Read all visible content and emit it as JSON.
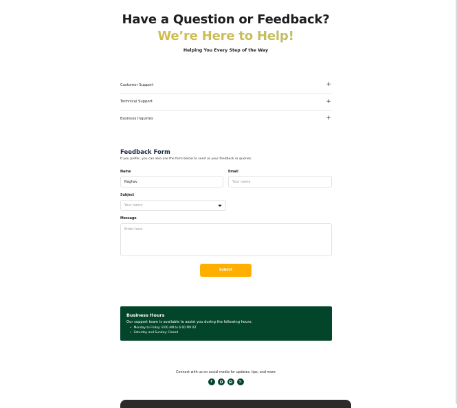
{
  "hero": {
    "title": "Have a Question or Feedback?",
    "subtitle": "We’re Here to Help!",
    "tagline": "Helping You Every Step of the Way"
  },
  "accordion": [
    {
      "label": "Customer Support",
      "icon": "plus-icon"
    },
    {
      "label": "Technical Support",
      "icon": "plus-icon"
    },
    {
      "label": "Business Inquiries",
      "icon": "plus-icon"
    }
  ],
  "form": {
    "title": "Feedback Form",
    "description": "If you prefer, you can also use the form below to send us your feedback or queries.",
    "name_label": "Name",
    "name_value": "Raghav",
    "email_label": "Email",
    "email_placeholder": "Your name",
    "subject_label": "Subject",
    "subject_placeholder": "Your name",
    "message_label": "Message",
    "message_placeholder": "Enter here",
    "submit_label": "Submit"
  },
  "business_hours": {
    "title": "Business Hours",
    "intro": "Our support team is available to assist you during the following hours:",
    "items": [
      "Monday to Friday: 9:00 AM to 6:00 PM IST",
      "Saturday and Sunday: Closed"
    ]
  },
  "social": {
    "text": "Connect with us on social media for updates, tips, and more",
    "icons": [
      "facebook-icon",
      "email-icon",
      "instagram-icon",
      "x-icon"
    ],
    "facebook_glyph": "f",
    "x_glyph": "𝕏"
  },
  "colors": {
    "accent": "#ffaf00",
    "brand_green": "#03452b",
    "heading_gradient": [
      "#e2b93b",
      "#8fc39a"
    ]
  }
}
